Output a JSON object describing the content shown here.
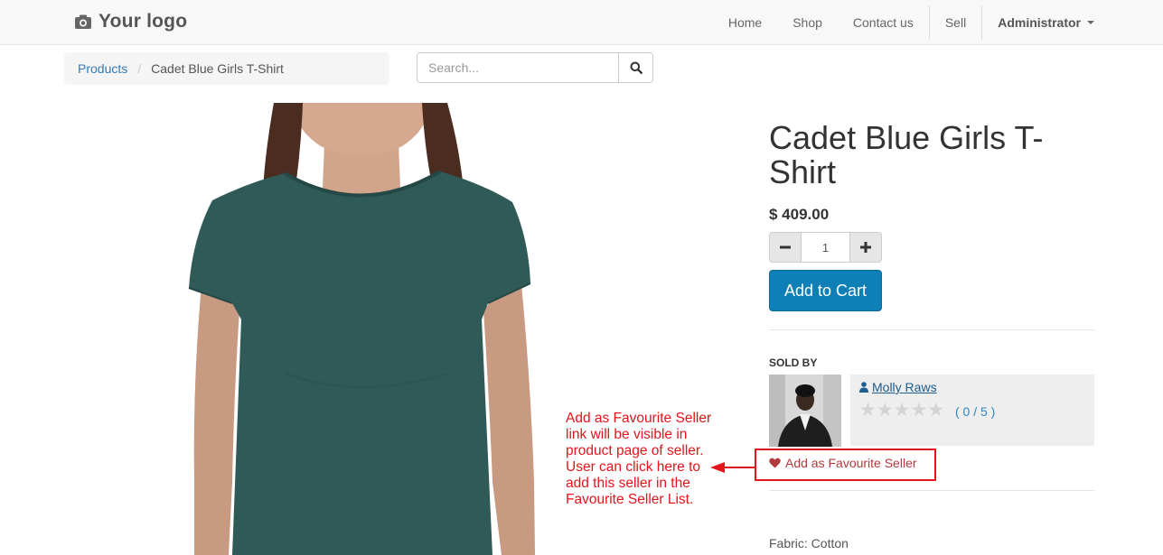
{
  "navbar": {
    "logo_text": "Your logo",
    "links": [
      "Home",
      "Shop",
      "Contact us",
      "Sell"
    ],
    "user": "Administrator"
  },
  "breadcrumb": {
    "parent": "Products",
    "current": "Cadet Blue Girls T-Shirt"
  },
  "search": {
    "placeholder": "Search..."
  },
  "product": {
    "title": "Cadet Blue Girls T-Shirt",
    "price": "$ 409.00",
    "quantity": "1",
    "add_to_cart": "Add to Cart",
    "fabric": "Fabric: Cotton",
    "shirt_color": "#2f5a58"
  },
  "seller": {
    "section_label": "SOLD BY",
    "name": "Molly Raws",
    "rating_text": "( 0 / 5 )",
    "rating_value": 0,
    "rating_max": 5,
    "favourite_link": "Add as Favourite Seller"
  },
  "annotation": {
    "lines": [
      "Add as Favourite Seller",
      "link will be visible in",
      "product page of seller.",
      "User can click here to",
      "add this seller in the",
      "Favourite Seller List."
    ],
    "color": "#e4141b"
  },
  "colors": {
    "accent": "#0f7fb7",
    "link": "#337ab7",
    "favourite": "#b2393c"
  }
}
